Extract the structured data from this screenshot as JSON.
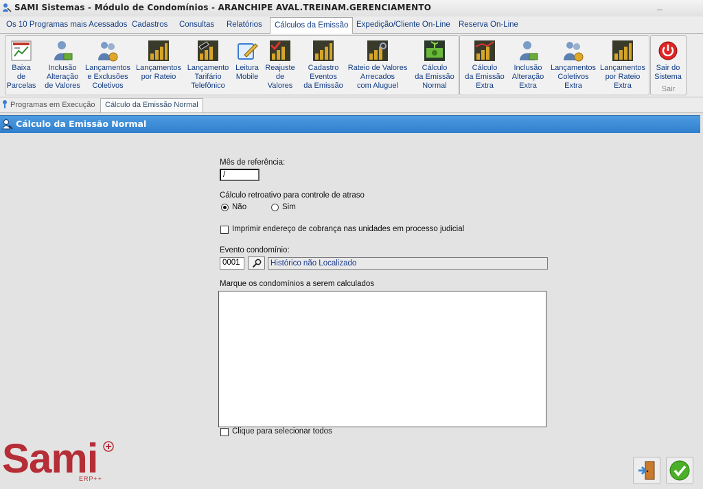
{
  "window": {
    "title": "SAMI Sistemas - Módulo de Condomínios - ARANCHIPE AVAL.TREINAM.GERENCIAMENTO",
    "minimize": "_"
  },
  "menu": {
    "tabs": [
      {
        "label": "Os 10 Programas mais Acessados"
      },
      {
        "label": "Cadastros"
      },
      {
        "label": "Consultas"
      },
      {
        "label": "Relatórios"
      },
      {
        "label": "Cálculos da Emissão"
      },
      {
        "label": "Expedição/Cliente On-Line"
      },
      {
        "label": "Reserva On-Line"
      }
    ],
    "active_index": 4
  },
  "ribbon": {
    "group1": [
      {
        "label": "Baixa\nde\nParcelas",
        "icon": "invoice-icon"
      },
      {
        "label": "Inclusão\nAlteração\nde Valores",
        "icon": "person-money-icon"
      },
      {
        "label": "Lançamentos\ne Exclusões\nColetivos",
        "icon": "people-money-icon"
      },
      {
        "label": "Lançamentos\npor Rateio",
        "icon": "coins-chart-icon"
      },
      {
        "label": "Lançamento\nTarifário\nTelefônico",
        "icon": "phone-coins-icon"
      },
      {
        "label": "Leitura\nMobile",
        "icon": "notepad-pencil-icon"
      },
      {
        "label": "Reajuste\nde\nValores",
        "icon": "coins-check-icon"
      },
      {
        "label": "Cadastro\nEventos\nda Emissão",
        "icon": "coins-chart-icon"
      },
      {
        "label": "Rateio de Valores\nArrecados\ncom Aluguel",
        "icon": "coins-key-icon"
      },
      {
        "label": "Cálculo\nda Emissão\nNormal",
        "icon": "money-plant-icon"
      }
    ],
    "group2": [
      {
        "label": "Cálculo\nda Emissão\nExtra",
        "icon": "coins-chart-red-icon"
      },
      {
        "label": "Inclusão\nAlteração\nExtra",
        "icon": "person-money-icon"
      },
      {
        "label": "Lançamentos\nColetivos\nExtra",
        "icon": "people-money-icon"
      },
      {
        "label": "Lançamentos\npor Rateio\nExtra",
        "icon": "coins-chart-icon"
      }
    ],
    "group3": {
      "button": {
        "label": "Sair do\nSistema",
        "icon": "power-icon"
      },
      "caption": "Sair"
    }
  },
  "doc_tabs": [
    {
      "label": "Programas em Execução"
    },
    {
      "label": "Cálculo da Emissão Normal"
    }
  ],
  "panel": {
    "title": "Cálculo da Emissão Normal"
  },
  "form": {
    "month_ref": {
      "label": "Mês de referência:",
      "value": " /"
    },
    "retro": {
      "label": "Cálculo retroativo para controle de atraso",
      "option_no": "Não",
      "option_yes": "Sim",
      "selected": "Não"
    },
    "print_address": {
      "label": "Imprimir endereço de cobrança nas unidades em processo judicial",
      "checked": false
    },
    "event": {
      "label": "Evento condomínio:",
      "code": "0001",
      "description": "Histórico não Localizado"
    },
    "condos": {
      "label": "Marque os condomínios a serem calculados",
      "items": []
    },
    "select_all": {
      "label": "Clique para selecionar todos",
      "checked": false
    }
  },
  "logo": {
    "text": "Sami",
    "sub": "ERP++"
  },
  "colors": {
    "header_blue": "#3a8ad6",
    "link_blue": "#123c83",
    "logo_red": "#b52d36",
    "background": "#e3e3e3"
  }
}
